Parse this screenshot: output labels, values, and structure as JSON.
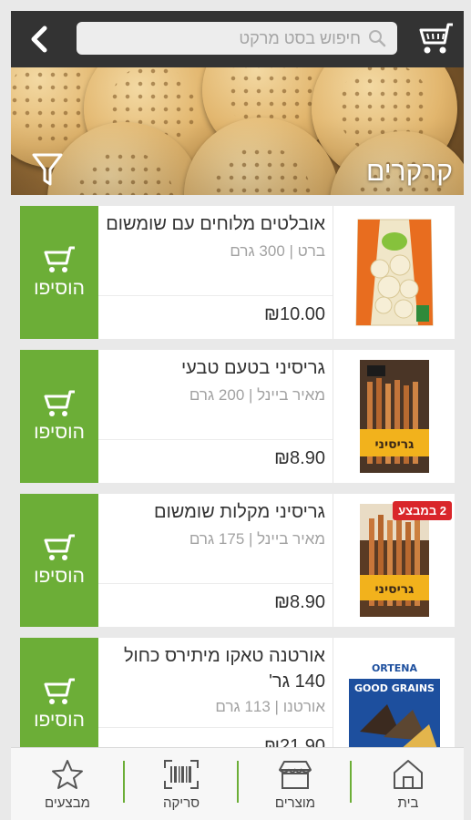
{
  "header": {
    "search_placeholder": "חיפוש בסט מרקט",
    "back_icon": "chevron-left-icon",
    "search_icon": "magnifier-icon",
    "cart_icon": "shopping-cart-icon"
  },
  "category": {
    "title": "קרקרים",
    "filter_icon": "funnel-icon"
  },
  "products": [
    {
      "name": "אובלטים מלוחים עם שומשום",
      "meta": "ברט | 300 גרם",
      "price": "₪10.00",
      "add_label": "הוסיפו",
      "badge": ""
    },
    {
      "name": "גריסיני בטעם טבעי",
      "meta": "מאיר ביינל | 200 גרם",
      "price": "₪8.90",
      "add_label": "הוסיפו",
      "badge": ""
    },
    {
      "name": "גריסיני מקלות שומשום",
      "meta": "מאיר ביינל | 175 גרם",
      "price": "₪8.90",
      "add_label": "הוסיפו",
      "badge": "2 במבצע"
    },
    {
      "name": "אורטנה טאקו מיתירס כחול 140 גר'",
      "meta": "אורטנו | 113 גרם",
      "price": "₪21.90",
      "add_label": "הוסיפו",
      "badge": ""
    }
  ],
  "package_text": {
    "grissini": "גריסיני",
    "good_grains": "GOOD GRAINS",
    "ortena": "ORTENA"
  },
  "bottom_nav": [
    {
      "label": "בית",
      "icon": "home-icon"
    },
    {
      "label": "מוצרים",
      "icon": "store-icon"
    },
    {
      "label": "סריקה",
      "icon": "barcode-icon"
    },
    {
      "label": "מבצעים",
      "icon": "star-icon"
    }
  ],
  "colors": {
    "accent_green": "#6cae37",
    "header_dark": "#333333",
    "badge_red": "#d9262a"
  }
}
